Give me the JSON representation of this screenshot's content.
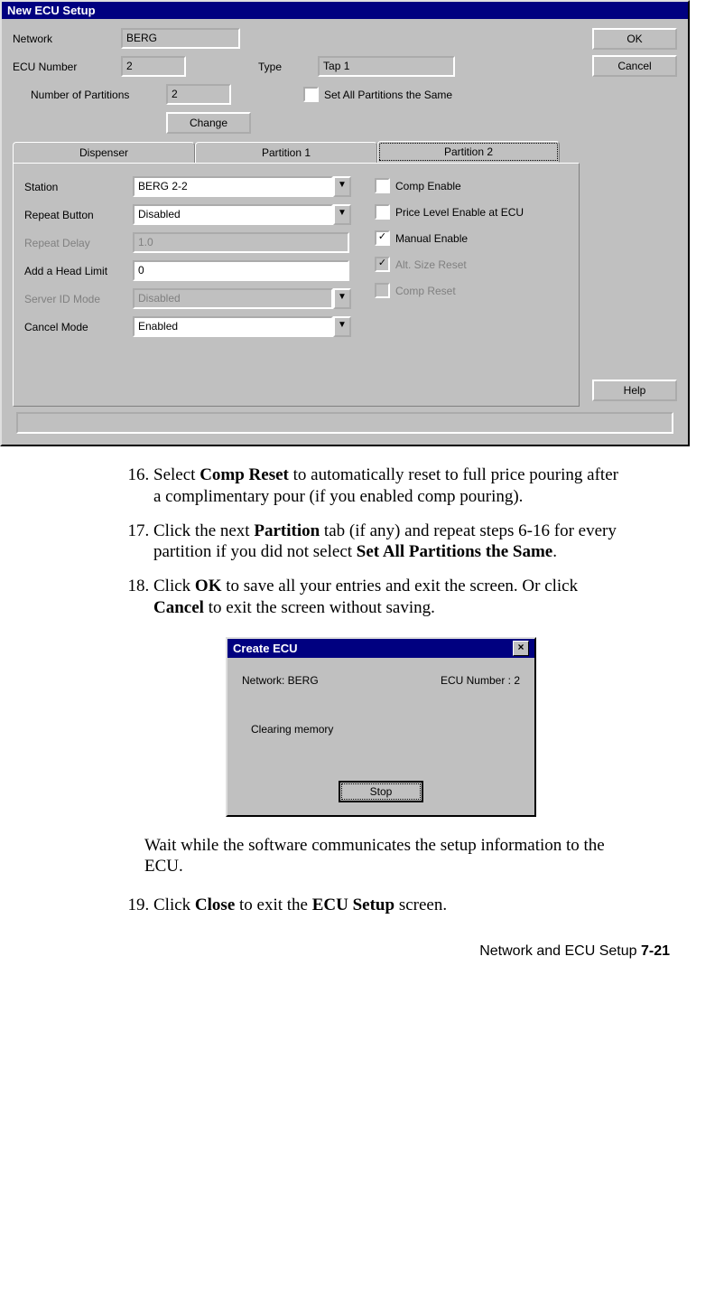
{
  "dialog1": {
    "title": "New ECU Setup",
    "ok": "OK",
    "cancel": "Cancel",
    "help": "Help",
    "network_label": "Network",
    "network_value": "BERG",
    "ecu_number_label": "ECU Number",
    "ecu_number_value": "2",
    "type_label": "Type",
    "type_value": "Tap 1",
    "num_partitions_label": "Number of Partitions",
    "num_partitions_value": "2",
    "change": "Change",
    "set_all_label": "Set All Partitions the Same",
    "tabs": [
      "Dispenser",
      "Partition 1",
      "Partition 2"
    ],
    "station_label": "Station",
    "station_value": "BERG 2-2",
    "repeat_button_label": "Repeat Button",
    "repeat_button_value": "Disabled",
    "repeat_delay_label": "Repeat Delay",
    "repeat_delay_value": "1.0",
    "head_limit_label": "Add a Head Limit",
    "head_limit_value": "0",
    "server_id_label": "Server ID Mode",
    "server_id_value": "Disabled",
    "cancel_mode_label": "Cancel Mode",
    "cancel_mode_value": "Enabled",
    "chk_comp_enable": "Comp Enable",
    "chk_price_level": "Price Level Enable at ECU",
    "chk_manual_enable": "Manual Enable",
    "chk_alt_size": "Alt. Size Reset",
    "chk_comp_reset": "Comp Reset"
  },
  "dialog2": {
    "title": "Create ECU",
    "network_label": "Network: BERG",
    "ecu_label": "ECU Number : 2",
    "status": "Clearing memory",
    "stop": "Stop"
  },
  "steps": {
    "s16a": "Select ",
    "s16b": "Comp Reset",
    "s16c": " to automatically reset to full price pouring after a complimentary pour (if you enabled comp pouring).",
    "s17a": "Click the next ",
    "s17b": "Partition",
    "s17c": " tab (if any) and repeat steps 6-16 for every partition if you did not select ",
    "s17d": "Set All Partitions the Same",
    "s17e": ".",
    "s18a": "Click ",
    "s18b": "OK",
    "s18c": " to save all your entries and exit the screen. Or click ",
    "s18d": "Cancel",
    "s18e": " to exit the screen without saving.",
    "wait": "Wait while the software communicates the setup information to the ECU.",
    "s19a": "Click ",
    "s19b": "Close",
    "s19c": " to exit the ",
    "s19d": "ECU Setup",
    "s19e": " screen."
  },
  "footer": {
    "text": "Network and ECU Setup  ",
    "page": "7-21"
  }
}
